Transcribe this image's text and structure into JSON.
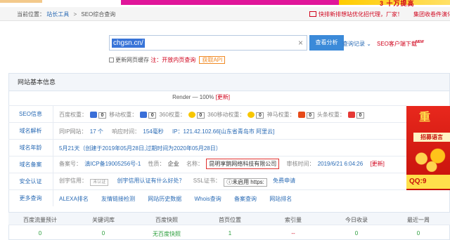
{
  "breadcrumb": {
    "prefix": "当前位置：",
    "item1": "站长工具",
    "sep": ">",
    "item2": "SEO综合查询"
  },
  "promos": {
    "left": "快排新排想站优化招代理，厂家！",
    "right": "集团收卷件演化"
  },
  "banner_text": "3 十万提高",
  "search": {
    "value": "chgsn.cn/",
    "button": "查看分析",
    "history": "查询记录",
    "client": "SEO客户端下载",
    "new_badge": "NEW",
    "checkbox_label": "更新网页缓存",
    "note": "注：开放内页查询",
    "api": "获取API"
  },
  "section_title": "网站基本信息",
  "render": {
    "text": "Render — 100%",
    "update": "[更新]"
  },
  "seo": {
    "label": "SEO信息",
    "baidu": "百度权重：",
    "baidu_val": "0",
    "mobile": "移动权重：",
    "mobile_val": "0",
    "s360": "360权重：",
    "s360_val": "0",
    "s360m": "360移动权重：",
    "s360m_val": "0",
    "shenma": "神马权重：",
    "shenma_val": "0",
    "toutiao": "头条权重：",
    "toutiao_val": "0"
  },
  "domain_parse": {
    "label": "域名解析",
    "same_ip": "同IP网站：",
    "same_ip_val": "17 个",
    "resp": "响应时间：",
    "resp_val": "154毫秒",
    "ip": "IP：121.42.102.66[山东省青岛市 阿里云]"
  },
  "domain_age": {
    "label": "域名年龄",
    "text": "5月21天（创建于2019年05月28日,过期时间为2020年05月28日）"
  },
  "icp": {
    "label": "域名备案",
    "num_label": "备案号：",
    "num": "滇ICP备19005256号-1",
    "nature_label": "性质：",
    "nature": "企业",
    "name_label": "名称：",
    "name": "昆明享鹅网络科技有限公司",
    "audit_label": "审核时间：",
    "audit": "2019/6/21 6:04:26",
    "update": "[更新]"
  },
  "security": {
    "label": "安全认证",
    "trust_label": "创宇信用：",
    "trust_badge": "未认证",
    "question": "创宇信用认证有什么好处？",
    "ssl_label": "SSL证书：",
    "ssl_val": "ⓘ未启用 https:",
    "free": "免费申请"
  },
  "more": {
    "label": "更多查询",
    "links": [
      "ALEXA排名",
      "友情链接检测",
      "网站历史数据",
      "Whois查询",
      "备案查询",
      "网站排名"
    ]
  },
  "ad": {
    "title": "重",
    "sub": "招募语言",
    "qq": "QQ:9"
  },
  "stats": {
    "headers": [
      "百度流量预计",
      "关键词库",
      "百度快照",
      "首页位置",
      "索引量",
      "今日收录",
      "最近一周"
    ],
    "values": [
      "0",
      "0",
      "无百度快照",
      "1",
      "--",
      "0",
      "0"
    ]
  },
  "colors": {
    "accent_blue": "#3b8ad9",
    "link_blue": "#2a6bb5",
    "alert_red": "#d0021b",
    "ok_green": "#2a9d3b"
  }
}
